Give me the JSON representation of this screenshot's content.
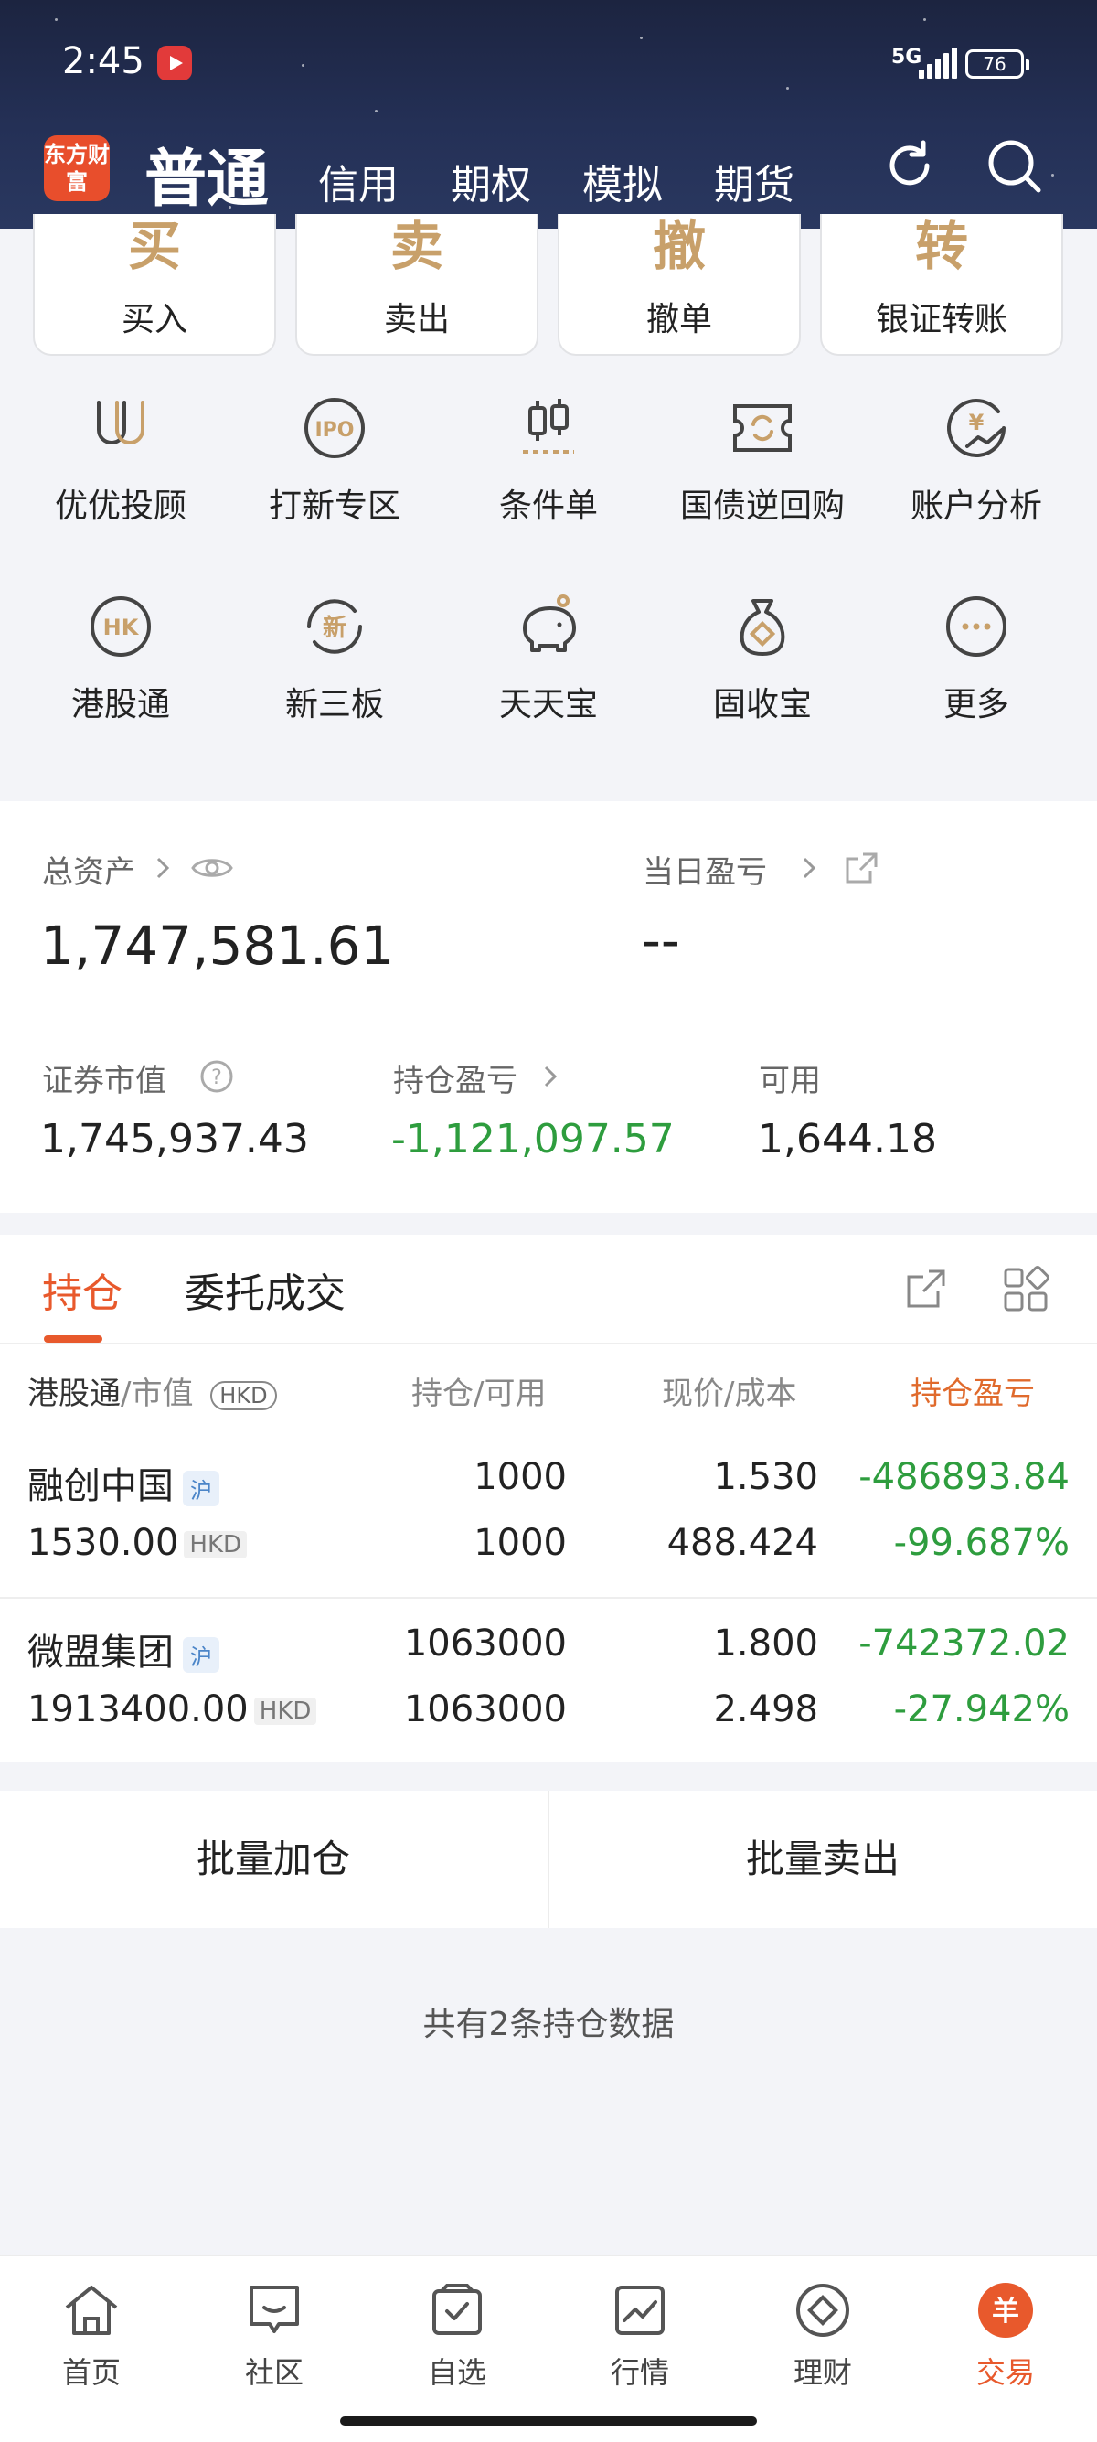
{
  "status_bar": {
    "time": "2:45",
    "network": "5G",
    "battery": "76"
  },
  "header": {
    "logo_text": "东方财富",
    "active_tab": "普通",
    "tabs": [
      "信用",
      "期权",
      "模拟",
      "期货"
    ]
  },
  "actions": [
    {
      "glyph": "买",
      "label": "买入"
    },
    {
      "glyph": "卖",
      "label": "卖出"
    },
    {
      "glyph": "撤",
      "label": "撤单"
    },
    {
      "glyph": "转",
      "label": "银证转账"
    }
  ],
  "features_row1": [
    {
      "label": "优优投顾",
      "icon": "youyou-icon"
    },
    {
      "label": "打新专区",
      "icon": "ipo-icon",
      "icon_text": "IPO"
    },
    {
      "label": "条件单",
      "icon": "candlestick-icon"
    },
    {
      "label": "国债逆回购",
      "icon": "bond-repo-icon"
    },
    {
      "label": "账户分析",
      "icon": "account-analysis-icon",
      "icon_text": "¥"
    }
  ],
  "features_row2": [
    {
      "label": "港股通",
      "icon": "hk-icon",
      "icon_text": "HK"
    },
    {
      "label": "新三板",
      "icon": "new-board-icon",
      "icon_text": "新"
    },
    {
      "label": "天天宝",
      "icon": "piggy-bank-icon"
    },
    {
      "label": "固收宝",
      "icon": "money-bag-icon"
    },
    {
      "label": "更多",
      "icon": "more-icon"
    }
  ],
  "assets": {
    "total_label": "总资产",
    "total_value": "1,747,581.61",
    "daily_pl_label": "当日盈亏",
    "daily_pl_value": "--",
    "market_value_label": "证券市值",
    "market_value": "1,745,937.43",
    "position_pl_label": "持仓盈亏",
    "position_pl_value": "-1,121,097.57",
    "available_label": "可用",
    "available_value": "1,644.18"
  },
  "positions": {
    "tabs": [
      "持仓",
      "委托成交"
    ],
    "header": {
      "col1_main": "港股通",
      "col1_sub": "/市值",
      "currency": "HKD",
      "col2": "持仓/可用",
      "col3": "现价/成本",
      "col4": "持仓盈亏"
    },
    "rows": [
      {
        "name": "融创中国",
        "market_tag": "沪",
        "market_value": "1530.00",
        "currency": "HKD",
        "holding": "1000",
        "available": "1000",
        "price": "1.530",
        "cost": "488.424",
        "pl": "-486893.84",
        "pl_pct": "-99.687%"
      },
      {
        "name": "微盟集团",
        "market_tag": "沪",
        "market_value": "1913400.00",
        "currency": "HKD",
        "holding": "1063000",
        "available": "1063000",
        "price": "1.800",
        "cost": "2.498",
        "pl": "-742372.02",
        "pl_pct": "-27.942%"
      }
    ]
  },
  "batch": {
    "add": "批量加仓",
    "sell": "批量卖出"
  },
  "summary": "共有2条持仓数据",
  "bottom_nav": [
    {
      "label": "首页",
      "icon": "home-icon"
    },
    {
      "label": "社区",
      "icon": "community-icon"
    },
    {
      "label": "自选",
      "icon": "watchlist-icon"
    },
    {
      "label": "行情",
      "icon": "market-icon"
    },
    {
      "label": "理财",
      "icon": "wealth-icon"
    },
    {
      "label": "交易",
      "icon": "trade-icon",
      "active": true,
      "glyph": "羊"
    }
  ],
  "colors": {
    "accent": "#e8592c",
    "gain_loss_negative": "#2e9d3e",
    "gold": "#c8a06a"
  }
}
